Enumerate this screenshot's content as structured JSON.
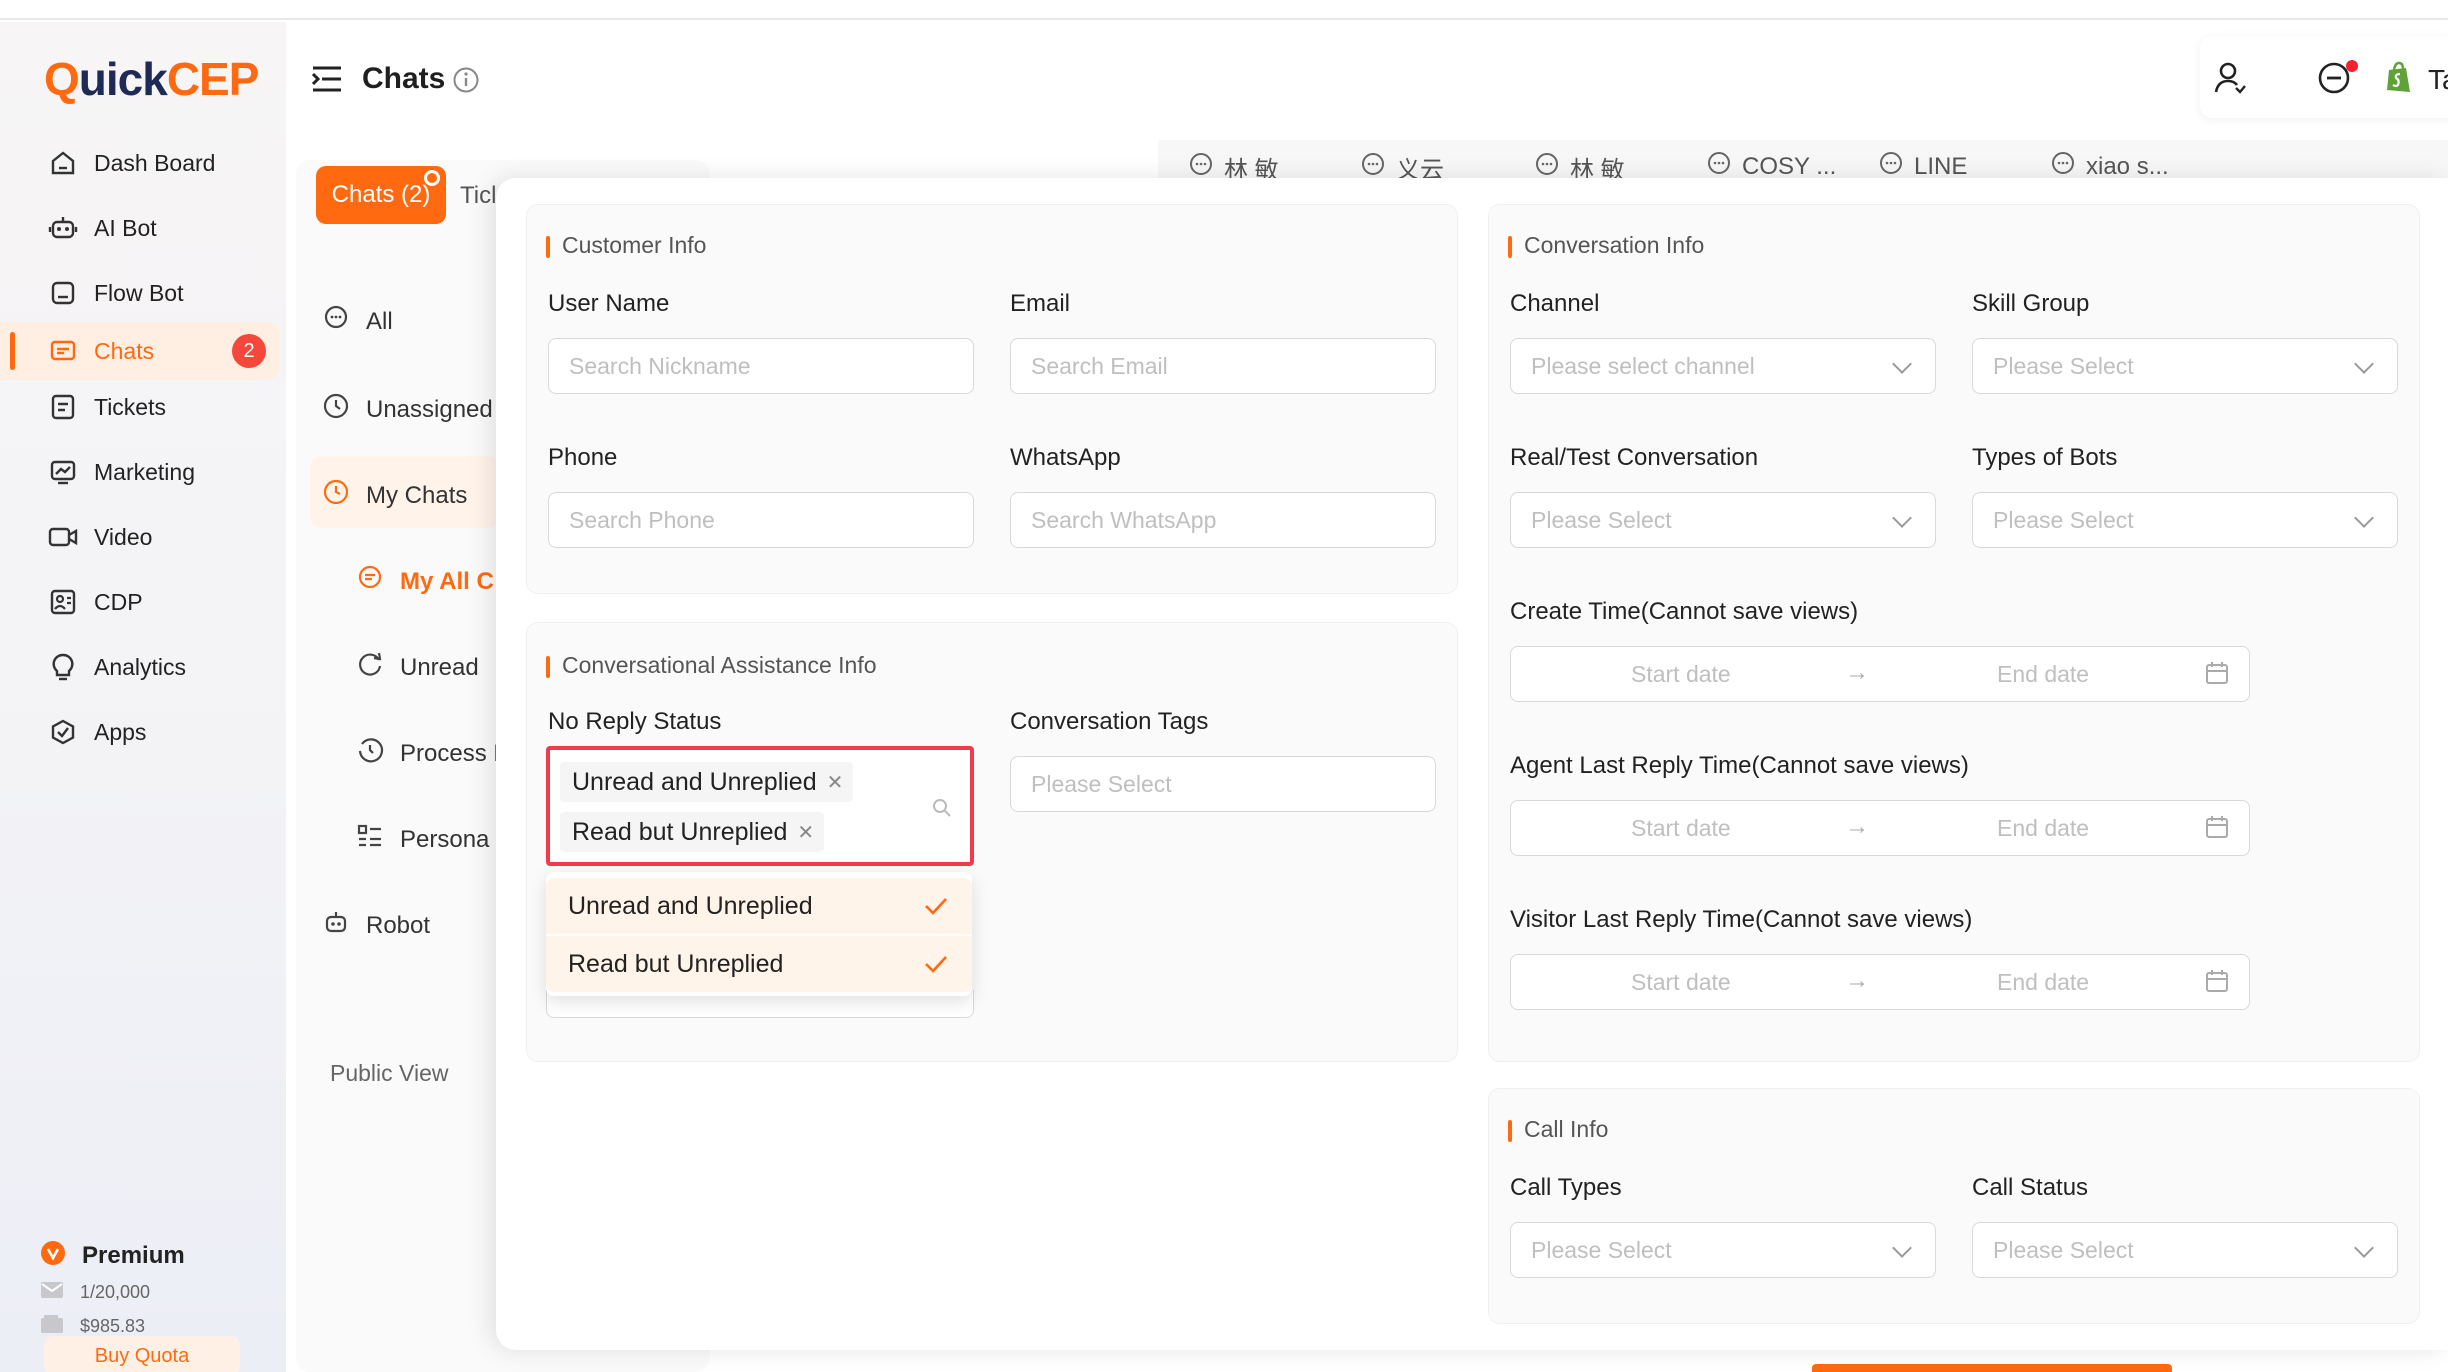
{
  "app": {
    "logo": {
      "q": "Q",
      "rest": "uick",
      "cep": "CEP"
    }
  },
  "sidebar": {
    "items": [
      {
        "label": "Dash Board",
        "icon": "home-icon"
      },
      {
        "label": "AI Bot",
        "icon": "robot-icon"
      },
      {
        "label": "Flow Bot",
        "icon": "flow-icon"
      },
      {
        "label": "Chats",
        "icon": "chat-icon",
        "badge": "2",
        "active": true
      },
      {
        "label": "Tickets",
        "icon": "ticket-icon"
      },
      {
        "label": "Marketing",
        "icon": "marketing-icon"
      },
      {
        "label": "Video",
        "icon": "video-icon"
      },
      {
        "label": "CDP",
        "icon": "cdp-icon"
      },
      {
        "label": "Analytics",
        "icon": "bulb-icon"
      },
      {
        "label": "Apps",
        "icon": "apps-icon"
      }
    ],
    "premium": {
      "title": "Premium",
      "quota": "1/20,000",
      "balance": "$985.83",
      "buy": "Buy Quota"
    }
  },
  "header": {
    "title": "Chats",
    "right_text": "Ta"
  },
  "left_panel": {
    "tabs": {
      "chats": "Chats (2)",
      "tickets": "Ticl"
    },
    "items": {
      "all": "All",
      "unassigned": "Unassigned",
      "mychats": "My Chats",
      "myall": "My All C",
      "unread": "Unread",
      "process": "Process L",
      "personal": "Persona",
      "robot": "Robot"
    },
    "public_view": "Public View"
  },
  "conversation_tabs": [
    "林 敏",
    "义云",
    "林 敏",
    "COSY ...",
    "LINE",
    "xiao s..."
  ],
  "filter": {
    "customer_info": {
      "title": "Customer Info",
      "user_name": {
        "label": "User Name",
        "placeholder": "Search Nickname"
      },
      "email": {
        "label": "Email",
        "placeholder": "Search Email"
      },
      "phone": {
        "label": "Phone",
        "placeholder": "Search Phone"
      },
      "whatsapp": {
        "label": "WhatsApp",
        "placeholder": "Search WhatsApp"
      }
    },
    "assistance_info": {
      "title": "Conversational Assistance Info",
      "no_reply_status": {
        "label": "No Reply Status",
        "selected": [
          "Unread and Unreplied",
          "Read but Unreplied"
        ],
        "options": [
          "Unread and Unreplied",
          "Read but Unreplied"
        ]
      },
      "conversation_tags": {
        "label": "Conversation Tags",
        "placeholder": "Please Select"
      }
    },
    "conversation_info": {
      "title": "Conversation Info",
      "channel": {
        "label": "Channel",
        "placeholder": "Please select channel"
      },
      "skill_group": {
        "label": "Skill Group",
        "placeholder": "Please Select"
      },
      "real_test": {
        "label": "Real/Test Conversation",
        "placeholder": "Please Select"
      },
      "bot_types": {
        "label": "Types of Bots",
        "placeholder": "Please Select"
      },
      "create_time": {
        "label": "Create Time(Cannot save views)",
        "start": "Start date",
        "end": "End date"
      },
      "agent_last_reply": {
        "label": "Agent Last Reply Time(Cannot save views)",
        "start": "Start date",
        "end": "End date"
      },
      "visitor_last_reply": {
        "label": "Visitor Last Reply Time(Cannot save views)",
        "start": "Start date",
        "end": "End date"
      }
    },
    "call_info": {
      "title": "Call Info",
      "call_types": {
        "label": "Call Types",
        "placeholder": "Please Select"
      },
      "call_status": {
        "label": "Call Status",
        "placeholder": "Please Select"
      }
    }
  },
  "colors": {
    "accent": "#ff6a10",
    "highlight": "#f03c4a",
    "badge": "#f5483b"
  }
}
